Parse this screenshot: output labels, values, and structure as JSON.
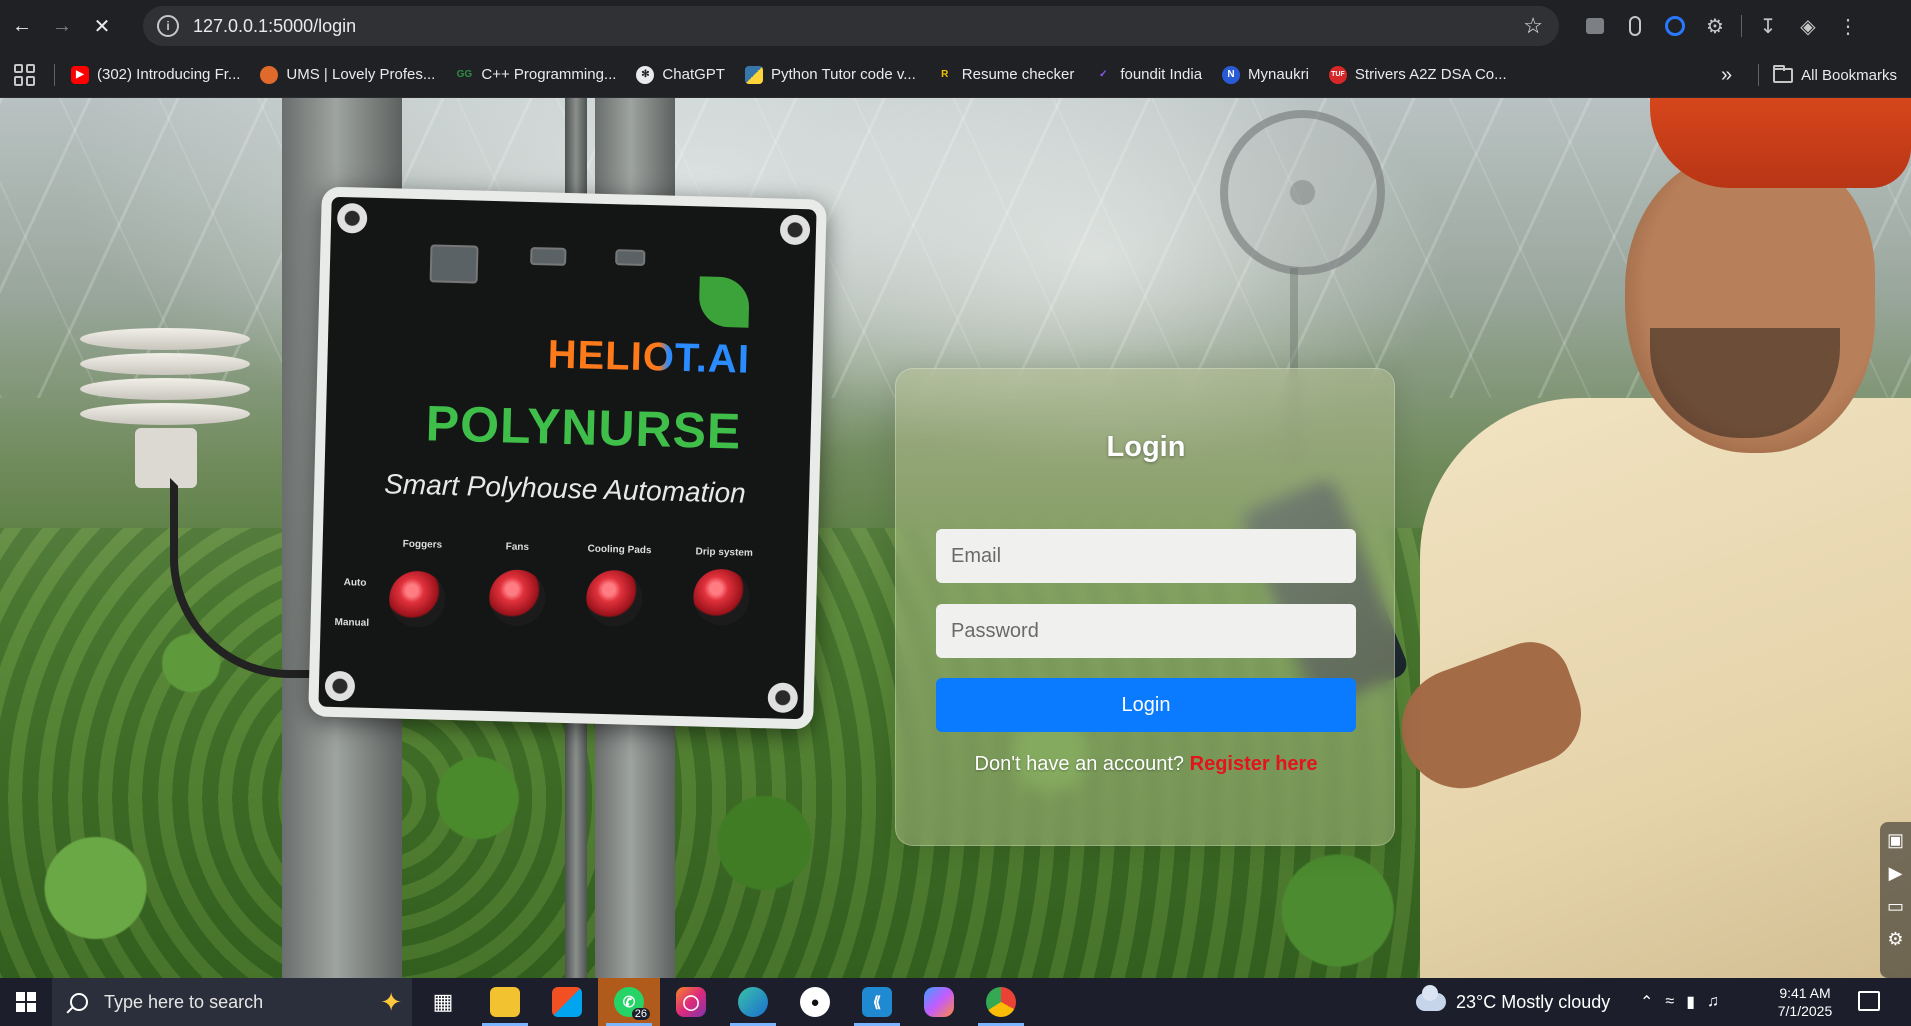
{
  "browser": {
    "url": "127.0.0.1:5000/login",
    "bookmarks": [
      {
        "label": "(302) Introducing Fr...",
        "icon": "youtube-icon",
        "color": "#ff0000"
      },
      {
        "label": "UMS | Lovely Profes...",
        "icon": "lpu-icon",
        "color": "#e06a2c"
      },
      {
        "label": "C++ Programming...",
        "icon": "geeksforgeeks-icon",
        "color": "#2f8d46"
      },
      {
        "label": "ChatGPT",
        "icon": "chatgpt-icon",
        "color": "#cfcfcf"
      },
      {
        "label": "Python Tutor code v...",
        "icon": "python-icon",
        "color": "#3776ab"
      },
      {
        "label": "Resume checker",
        "icon": "resume-icon",
        "color": "#f2c200"
      },
      {
        "label": "foundit India",
        "icon": "foundit-icon",
        "color": "#6b3fd4"
      },
      {
        "label": "Mynaukri",
        "icon": "naukri-icon",
        "color": "#2a5bd7"
      },
      {
        "label": "Strivers A2Z DSA Co...",
        "icon": "tuf-icon",
        "color": "#d62828"
      }
    ],
    "all_bookmarks": "All Bookmarks"
  },
  "background": {
    "box_brand": "HELIOT.AI",
    "box_product": "POLYNURSE",
    "box_tagline": "Smart Polyhouse Automation",
    "box_labels": [
      "Foggers",
      "Fans",
      "Cooling Pads",
      "Drip system"
    ],
    "box_mode_labels": [
      "Auto",
      "Manual"
    ]
  },
  "login": {
    "title": "Login",
    "email_placeholder": "Email",
    "password_placeholder": "Password",
    "button": "Login",
    "register_prompt": "Don't have an account?",
    "register_link": "Register here",
    "accent_color": "#0a7bff",
    "link_color": "#e3141b"
  },
  "taskbar": {
    "search_placeholder": "Type here to search",
    "whatsapp_badge": "26",
    "weather": "23°C  Mostly cloudy",
    "time": "9:41 AM",
    "date": "7/1/2025"
  }
}
